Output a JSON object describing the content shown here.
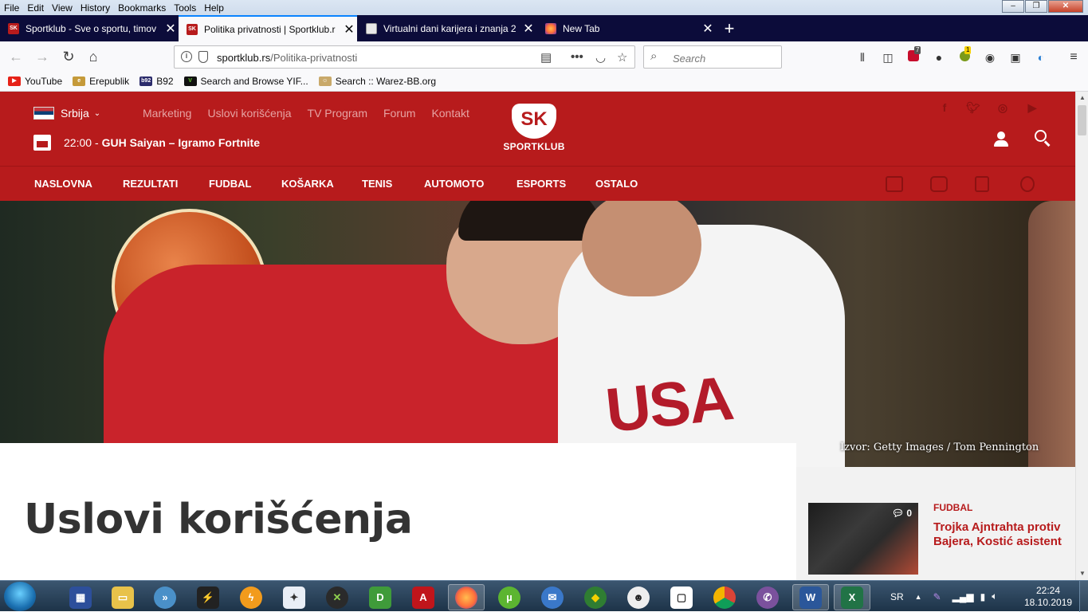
{
  "menubar": {
    "items": [
      "File",
      "Edit",
      "View",
      "History",
      "Bookmarks",
      "Tools",
      "Help"
    ]
  },
  "tabs": [
    {
      "title": "Sportklub - Sve o sportu, timov",
      "favicon": "SK"
    },
    {
      "title": "Politika privatnosti | Sportklub.r",
      "favicon": "SK",
      "active": true
    },
    {
      "title": "Virtualni dani karijera i znanja 2",
      "favicon": ""
    },
    {
      "title": "New Tab",
      "favicon": ""
    }
  ],
  "url": {
    "domain": "sportklub.rs",
    "path": "/Politika-privatnosti"
  },
  "search": {
    "placeholder": "Search"
  },
  "toolbar": {
    "abp_count": "7",
    "ext_badge": "1"
  },
  "bookmarks": [
    "YouTube",
    "Erepublik",
    "B92",
    "Search and Browse YIF...",
    "Search :: Warez-BB.org"
  ],
  "site": {
    "country": "Srbija",
    "topnav": [
      "Marketing",
      "Uslovi korišćenja",
      "TV Program",
      "Forum",
      "Kontakt"
    ],
    "tv": {
      "time": "22:00",
      "separator": "-",
      "show": "GUH Saiyan – Igramo Fortnite"
    },
    "logo": {
      "mark": "SK",
      "word": "SPORTKLUB"
    },
    "mainnav": [
      "NASLOVNA",
      "REZULTATI",
      "FUDBAL",
      "KOŠARKA",
      "TENIS",
      "AUTOMOTO",
      "ESPORTS",
      "OSTALO"
    ],
    "hero_caption": "Izvor: Getty Images / Tom Pennington",
    "page_title": "Uslovi korišćenja",
    "sidebar": {
      "category": "FUDBAL",
      "title": "Trojka Ajntrahta protiv Bajera, Kostić asistent",
      "comments": "0"
    },
    "colors": {
      "brand": "#b71b1c"
    }
  },
  "taskbar": {
    "lang": "SR",
    "time": "22:24",
    "date": "18.10.2019"
  }
}
